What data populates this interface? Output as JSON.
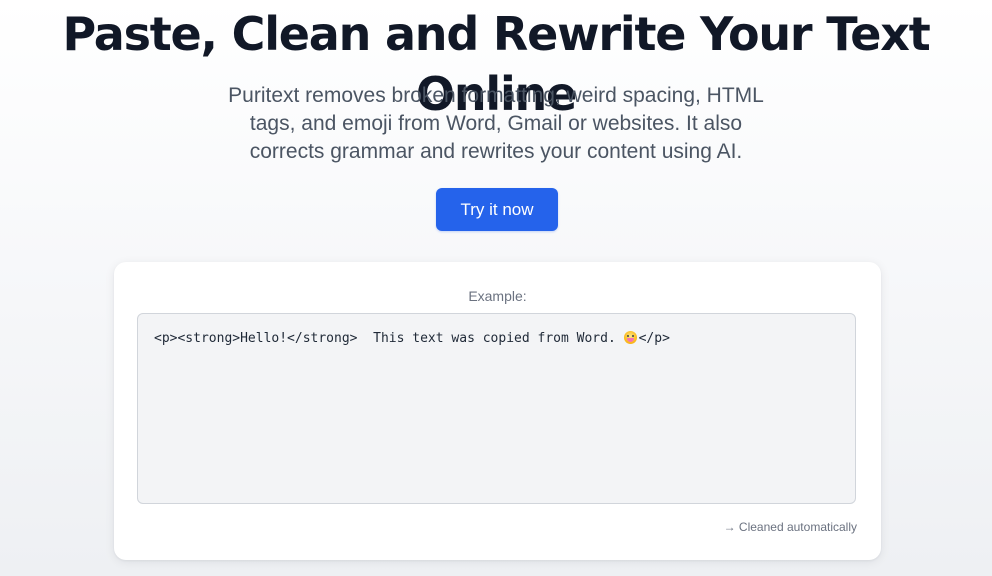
{
  "hero": {
    "title": "Paste, Clean and Rewrite Your Text Online",
    "subtitle": "Puritext removes broken formatting, weird spacing, HTML tags, and emoji from Word, Gmail or websites. It also corrects grammar and rewrites your content using AI.",
    "cta_label": "Try it now"
  },
  "example": {
    "label": "Example:",
    "code_before_emoji": "<p><strong>Hello!</strong>  This text was copied from Word. ",
    "emoji_icon": "drooling-face-emoji-icon",
    "code_after_emoji": "</p>",
    "note": "→ Cleaned automatically"
  },
  "colors": {
    "accent": "#2563eb",
    "title": "#111827",
    "subtitle": "#4b5563",
    "muted": "#6b7280",
    "code_bg": "#f3f4f6"
  }
}
